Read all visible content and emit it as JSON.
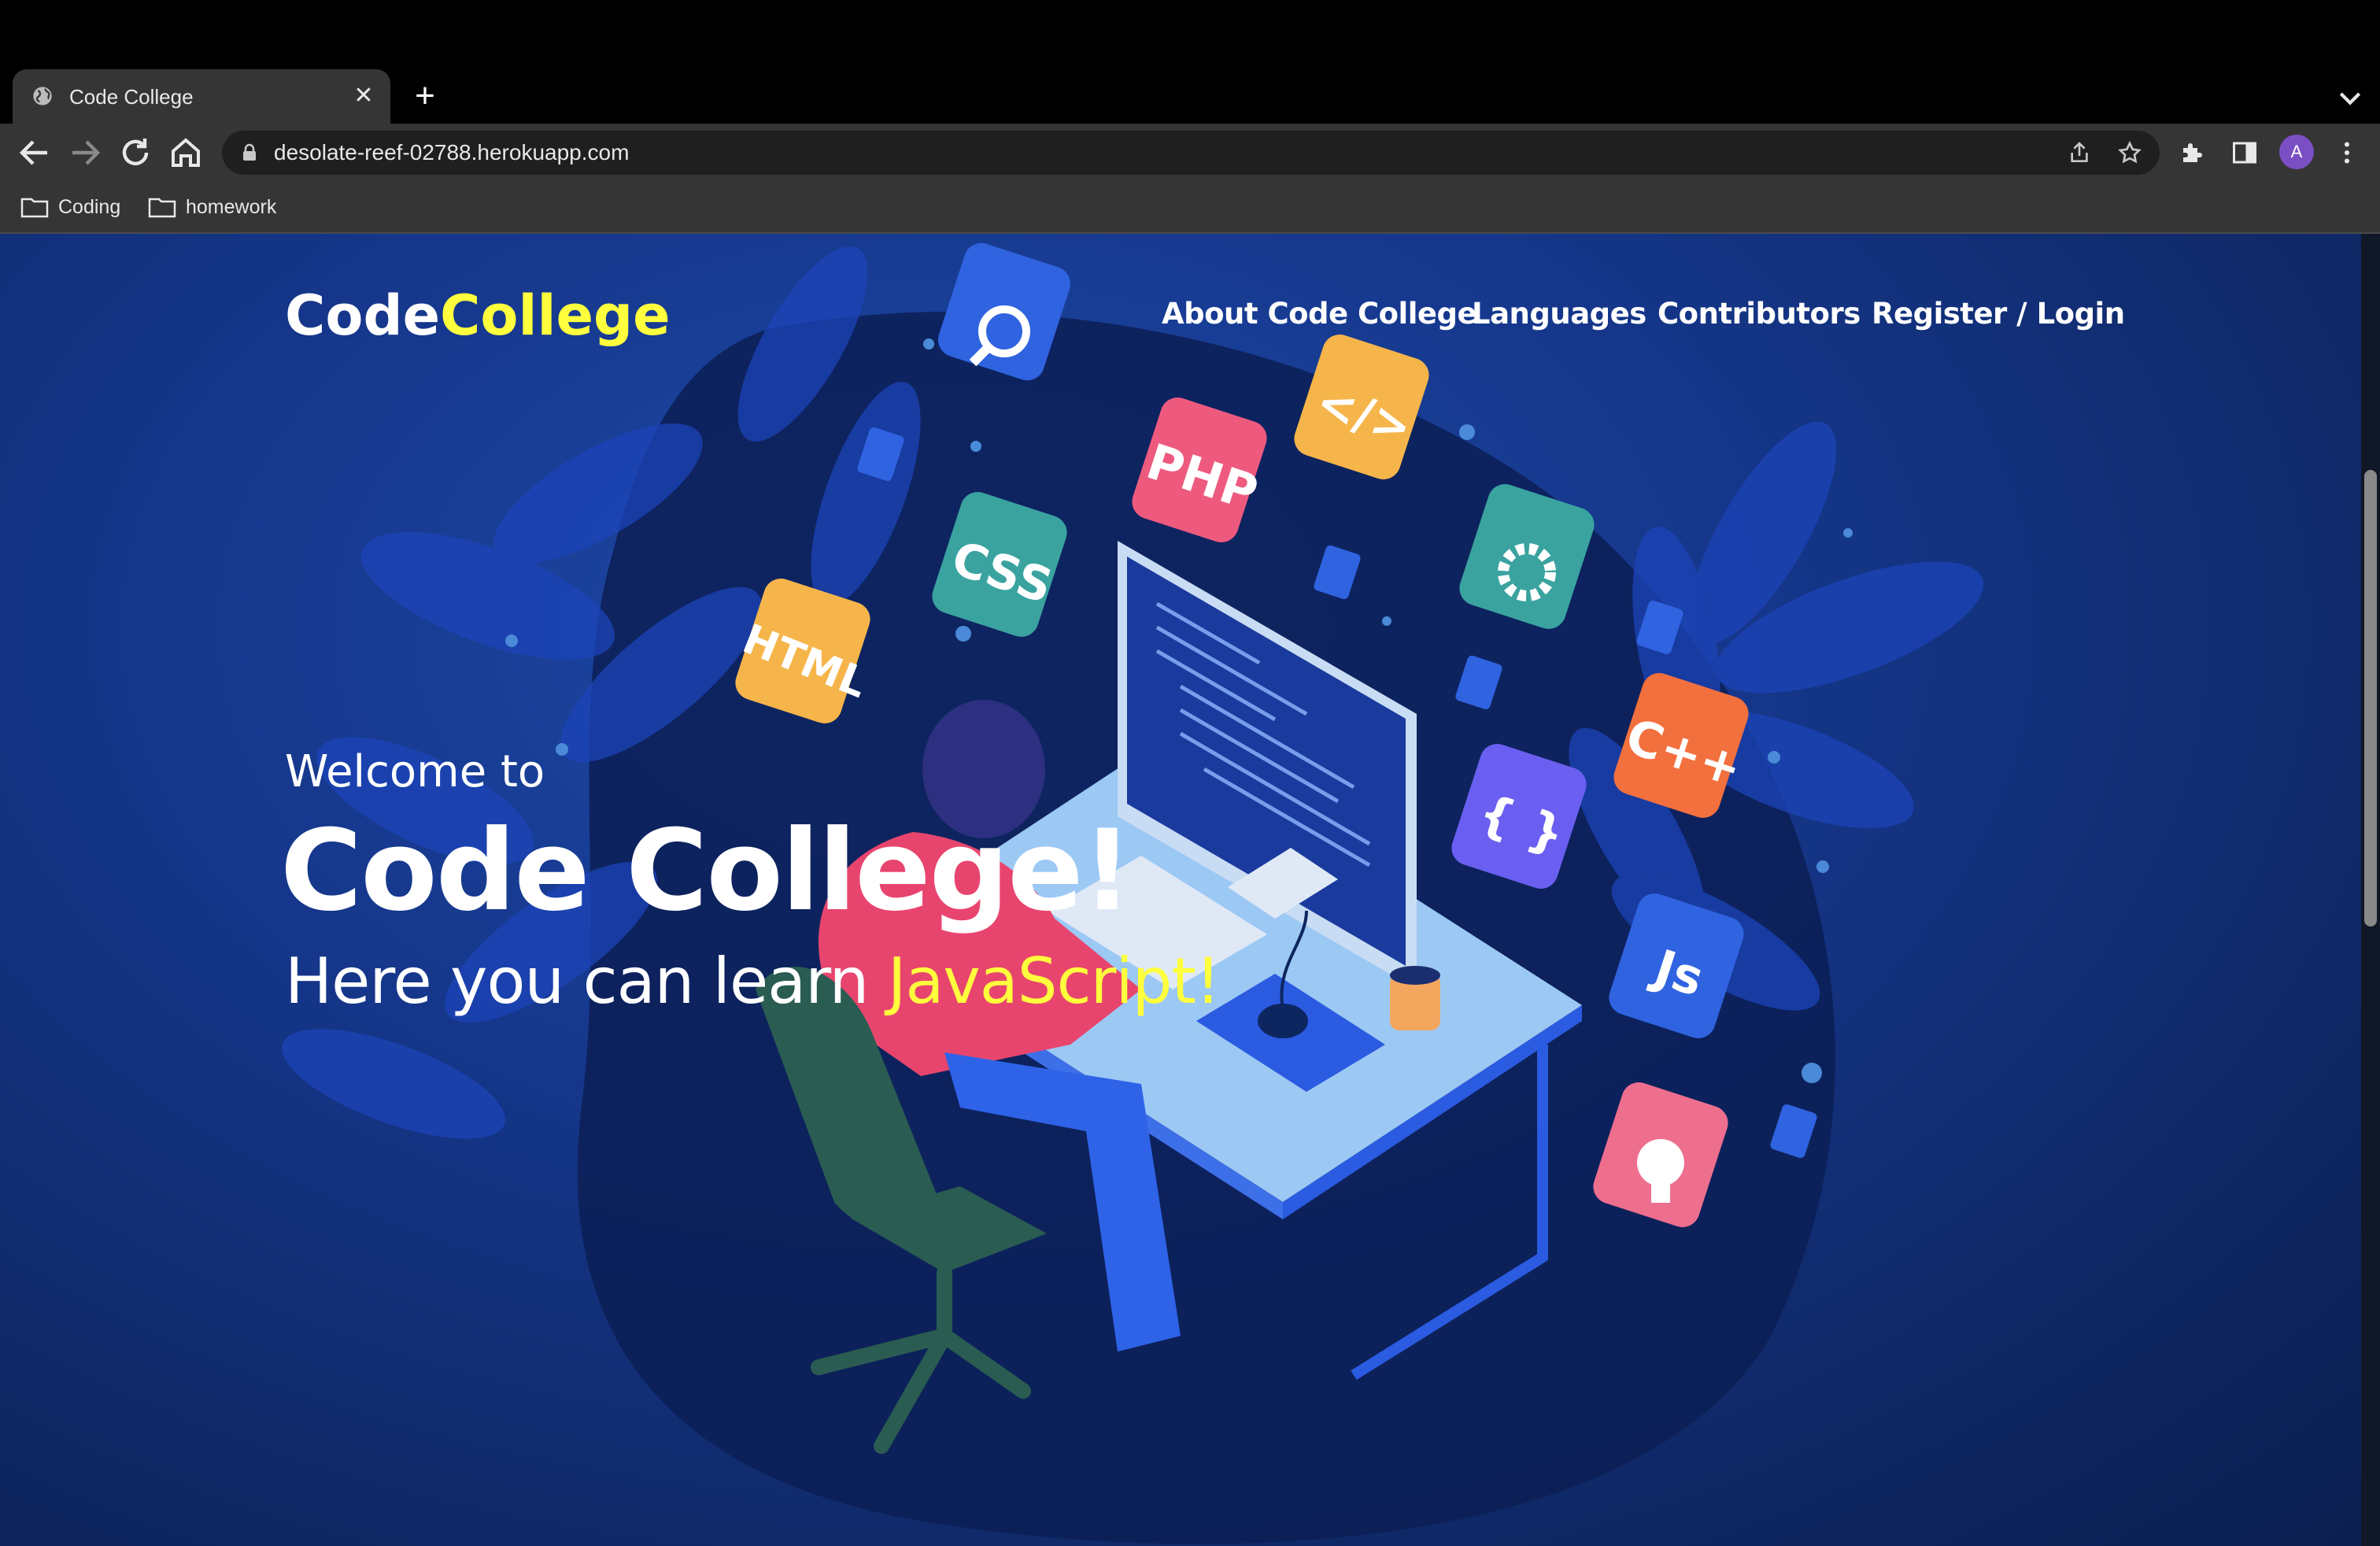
{
  "browser": {
    "tab_title": "Code College",
    "url": "desolate-reef-02788.herokuapp.com",
    "avatar_letter": "A",
    "bookmarks": [
      "Coding",
      "homework"
    ]
  },
  "site": {
    "logo_part1": "Code",
    "logo_part2": "College",
    "nav": [
      "About Code College",
      "Languages",
      "Contributors",
      "Register / Login"
    ],
    "hero": {
      "welcome": "Welcome to",
      "title": "Code College!",
      "subtitle_prefix": "Here you can learn ",
      "subtitle_highlight": "JavaScript!"
    },
    "illustration_labels": [
      "PHP",
      "CSS",
      "HTML",
      "C++",
      "{ }",
      "Js",
      "</>"
    ]
  },
  "colors": {
    "accent_yellow": "#ffff3d",
    "page_blue": "#15368a",
    "chrome_dark": "#353535"
  }
}
